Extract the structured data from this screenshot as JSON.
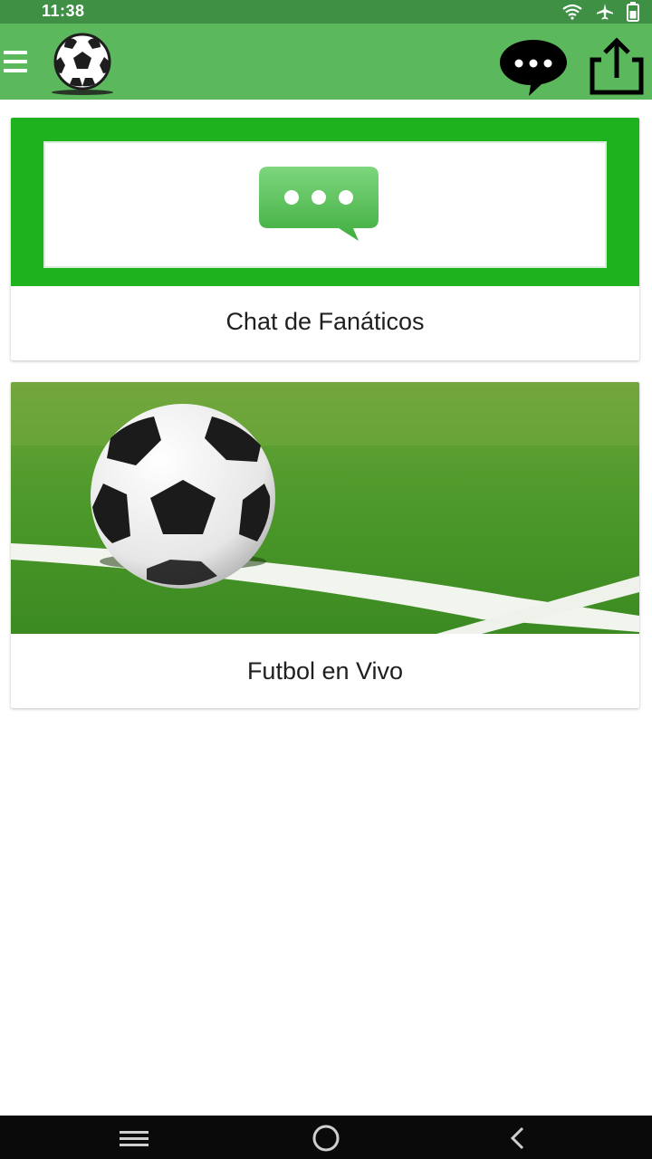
{
  "status_bar": {
    "time": "11:38",
    "icons": [
      "wifi-icon",
      "airplane-icon",
      "battery-icon"
    ]
  },
  "app_bar": {
    "menu_icon": "hamburger-menu-icon",
    "logo_icon": "soccer-ball-logo",
    "actions": [
      "chat-bubble-icon",
      "share-icon"
    ],
    "color": "#5cb85c"
  },
  "cards": [
    {
      "title": "Chat de Fanáticos",
      "image": "chat-bubble-illustration",
      "banner_color": "#1fb21f"
    },
    {
      "title": "Futbol en Vivo",
      "image": "soccer-ball-on-grass-photo"
    }
  ],
  "nav_bar": {
    "buttons": [
      "recent-apps-icon",
      "home-icon",
      "back-icon"
    ]
  },
  "colors": {
    "status_bar": "#3f8f45",
    "accent_green": "#1fb21f",
    "text": "#1f1f1f"
  }
}
